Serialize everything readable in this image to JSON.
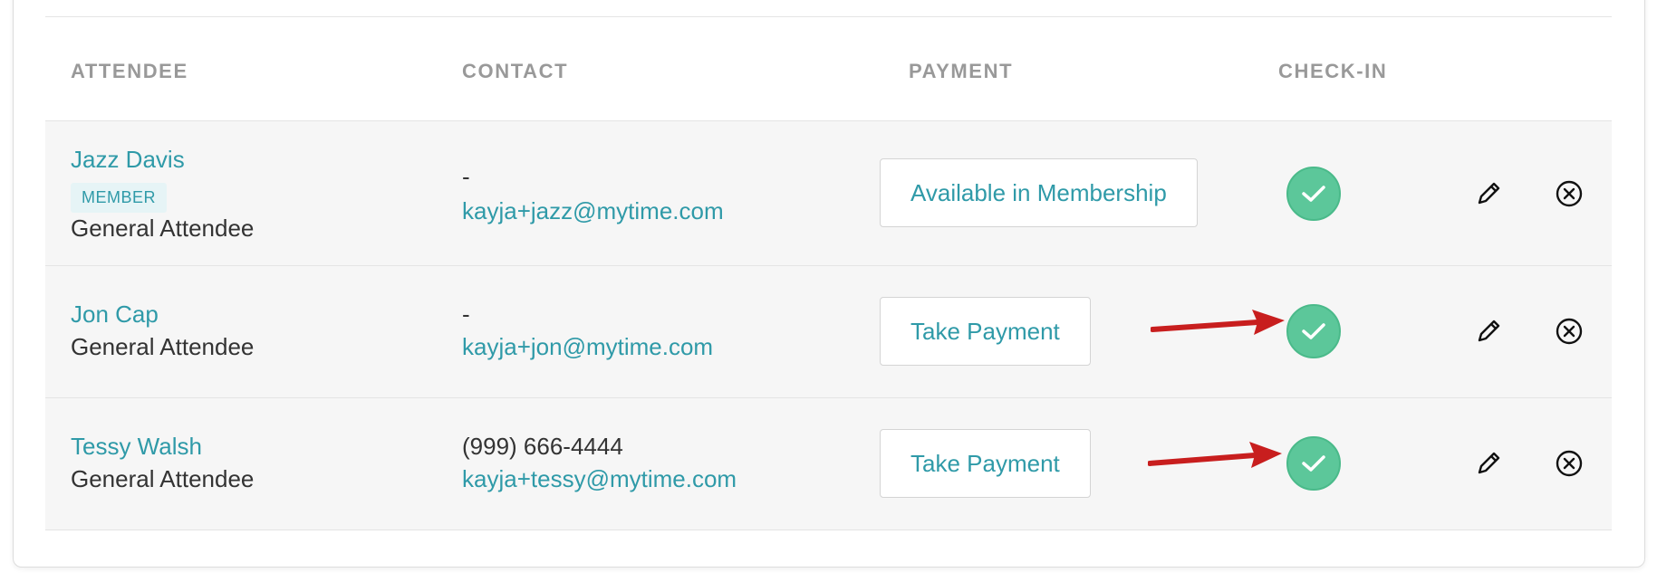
{
  "table": {
    "headers": {
      "attendee": "ATTENDEE",
      "contact": "CONTACT",
      "payment": "PAYMENT",
      "checkin": "CHECK-IN"
    },
    "rows": [
      {
        "name": "Jazz Davis",
        "badge": "MEMBER",
        "role": "General Attendee",
        "phone": "-",
        "email": "kayja+jazz@mytime.com",
        "payment_label": "Available in Membership",
        "checked_in": true
      },
      {
        "name": "Jon Cap",
        "role": "General Attendee",
        "phone": "-",
        "email": "kayja+jon@mytime.com",
        "payment_label": "Take Payment",
        "checked_in": true
      },
      {
        "name": "Tessy Walsh",
        "role": "General Attendee",
        "phone": "(999) 666-4444",
        "email": "kayja+tessy@mytime.com",
        "payment_label": "Take Payment",
        "checked_in": true
      }
    ]
  },
  "icons": {
    "checkin": "check-circle-icon",
    "edit": "pencil-icon",
    "remove": "close-circle-icon",
    "annotation": "red-arrow-icon"
  },
  "colors": {
    "link": "#2f9aa8",
    "checked": "#5cc79a",
    "row_bg": "#f6f6f6",
    "header_text": "#999999",
    "annotation_arrow": "#c81e1e"
  }
}
